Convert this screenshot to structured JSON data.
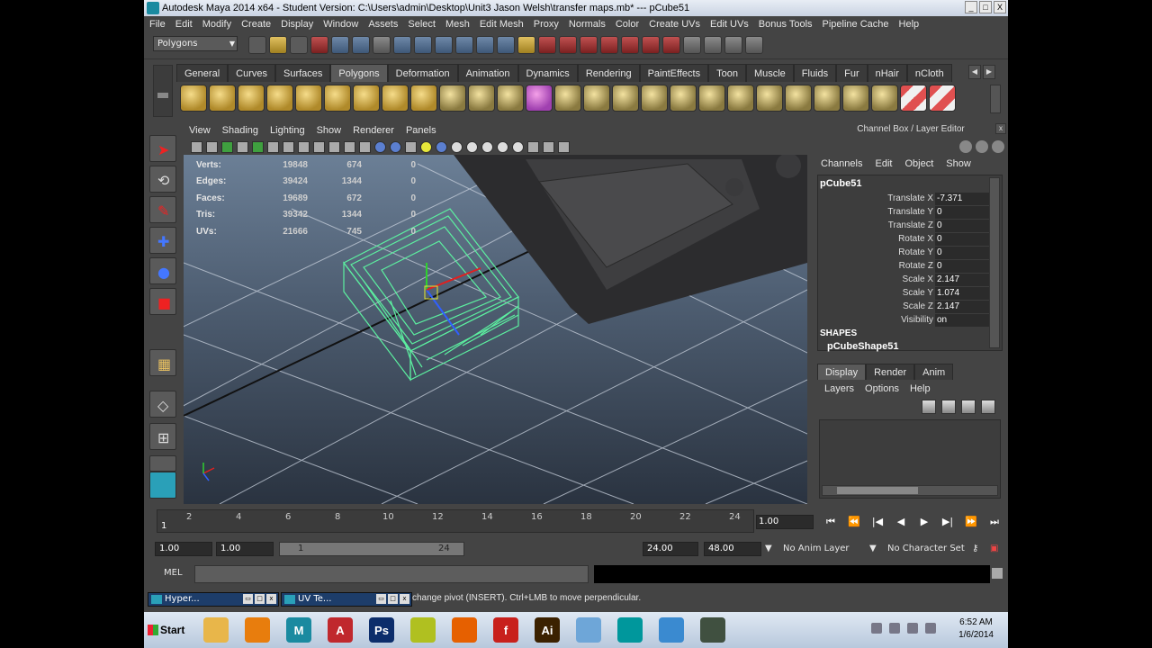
{
  "window": {
    "title": "Autodesk Maya 2014 x64 - Student Version: C:\\Users\\admin\\Desktop\\Unit3 Jason Welsh\\transfer maps.mb*   ---   pCube51",
    "min": "_",
    "max": "□",
    "close": "X"
  },
  "menubar": [
    "File",
    "Edit",
    "Modify",
    "Create",
    "Display",
    "Window",
    "Assets",
    "Select",
    "Mesh",
    "Edit Mesh",
    "Proxy",
    "Normals",
    "Color",
    "Create UVs",
    "Edit UVs",
    "Bonus Tools",
    "Pipeline Cache",
    "Help"
  ],
  "status_line": {
    "mode": "Polygons"
  },
  "shelf": {
    "tabs": [
      "General",
      "Curves",
      "Surfaces",
      "Polygons",
      "Deformation",
      "Animation",
      "Dynamics",
      "Rendering",
      "PaintEffects",
      "Toon",
      "Muscle",
      "Fluids",
      "Fur",
      "nHair",
      "nCloth"
    ],
    "active_tab": "Polygons"
  },
  "viewport": {
    "menu": [
      "View",
      "Shading",
      "Lighting",
      "Show",
      "Renderer",
      "Panels"
    ],
    "hud": [
      {
        "label": "Verts:",
        "v1": "19848",
        "v2": "674",
        "v3": "0"
      },
      {
        "label": "Edges:",
        "v1": "39424",
        "v2": "1344",
        "v3": "0"
      },
      {
        "label": "Faces:",
        "v1": "19689",
        "v2": "672",
        "v3": "0"
      },
      {
        "label": "Tris:",
        "v1": "39342",
        "v2": "1344",
        "v3": "0"
      },
      {
        "label": "UVs:",
        "v1": "21666",
        "v2": "745",
        "v3": "0"
      }
    ]
  },
  "channel_box": {
    "title": "Channel Box / Layer Editor",
    "menu": [
      "Channels",
      "Edit",
      "Object",
      "Show"
    ],
    "object": "pCube51",
    "attrs": [
      {
        "name": "Translate X",
        "value": "-7.371"
      },
      {
        "name": "Translate Y",
        "value": "0"
      },
      {
        "name": "Translate Z",
        "value": "0"
      },
      {
        "name": "Rotate X",
        "value": "0"
      },
      {
        "name": "Rotate Y",
        "value": "0"
      },
      {
        "name": "Rotate Z",
        "value": "0"
      },
      {
        "name": "Scale X",
        "value": "2.147"
      },
      {
        "name": "Scale Y",
        "value": "1.074"
      },
      {
        "name": "Scale Z",
        "value": "2.147"
      },
      {
        "name": "Visibility",
        "value": "on"
      }
    ],
    "shapes_header": "SHAPES",
    "shape_name": "pCubeShape51"
  },
  "layer_editor": {
    "tabs": [
      "Display",
      "Render",
      "Anim"
    ],
    "active_tab": "Display",
    "menu": [
      "Layers",
      "Options",
      "Help"
    ]
  },
  "timeline": {
    "ticks": [
      "2",
      "4",
      "6",
      "8",
      "10",
      "12",
      "14",
      "16",
      "18",
      "20",
      "22",
      "24"
    ],
    "current_frame_label": "1",
    "current_time": "1.00",
    "buttons": [
      "⏮",
      "⏪",
      "|◀",
      "◀",
      "▶",
      "▶|",
      "⏩",
      "⏭"
    ]
  },
  "range": {
    "start": "1.00",
    "playback_start": "1.00",
    "slider_start": "1",
    "slider_end": "24",
    "playback_end": "24.00",
    "end": "48.00",
    "anim_layer": "No Anim Layer",
    "character_set": "No Character Set"
  },
  "command": {
    "label": "MEL"
  },
  "help_line": {
    "windows": [
      {
        "title": "Hyper..."
      },
      {
        "title": "UV Te..."
      }
    ],
    "text": "change pivot (INSERT).  Ctrl+LMB to move perpendicular."
  },
  "taskbar": {
    "start": "Start",
    "apps": [
      {
        "name": "explorer",
        "label": "",
        "color": "#e8b64a"
      },
      {
        "name": "blender",
        "label": "",
        "color": "#e87d0d"
      },
      {
        "name": "maya",
        "label": "M",
        "color": "#1a8aa0"
      },
      {
        "name": "autocad",
        "label": "A",
        "color": "#c0282d"
      },
      {
        "name": "photoshop",
        "label": "Ps",
        "color": "#0c2d6b"
      },
      {
        "name": "sketchup",
        "label": "",
        "color": "#b0c020"
      },
      {
        "name": "firefox",
        "label": "",
        "color": "#e66000"
      },
      {
        "name": "flash",
        "label": "f",
        "color": "#c8201c"
      },
      {
        "name": "illustrator",
        "label": "Ai",
        "color": "#3b2100"
      },
      {
        "name": "calculator",
        "label": "",
        "color": "#6ea6d8"
      },
      {
        "name": "arduino",
        "label": "",
        "color": "#00979c"
      },
      {
        "name": "control-panel",
        "label": "",
        "color": "#3a8ad0"
      },
      {
        "name": "game",
        "label": "",
        "color": "#405040"
      }
    ],
    "time": "6:52 AM",
    "date": "1/6/2014"
  }
}
